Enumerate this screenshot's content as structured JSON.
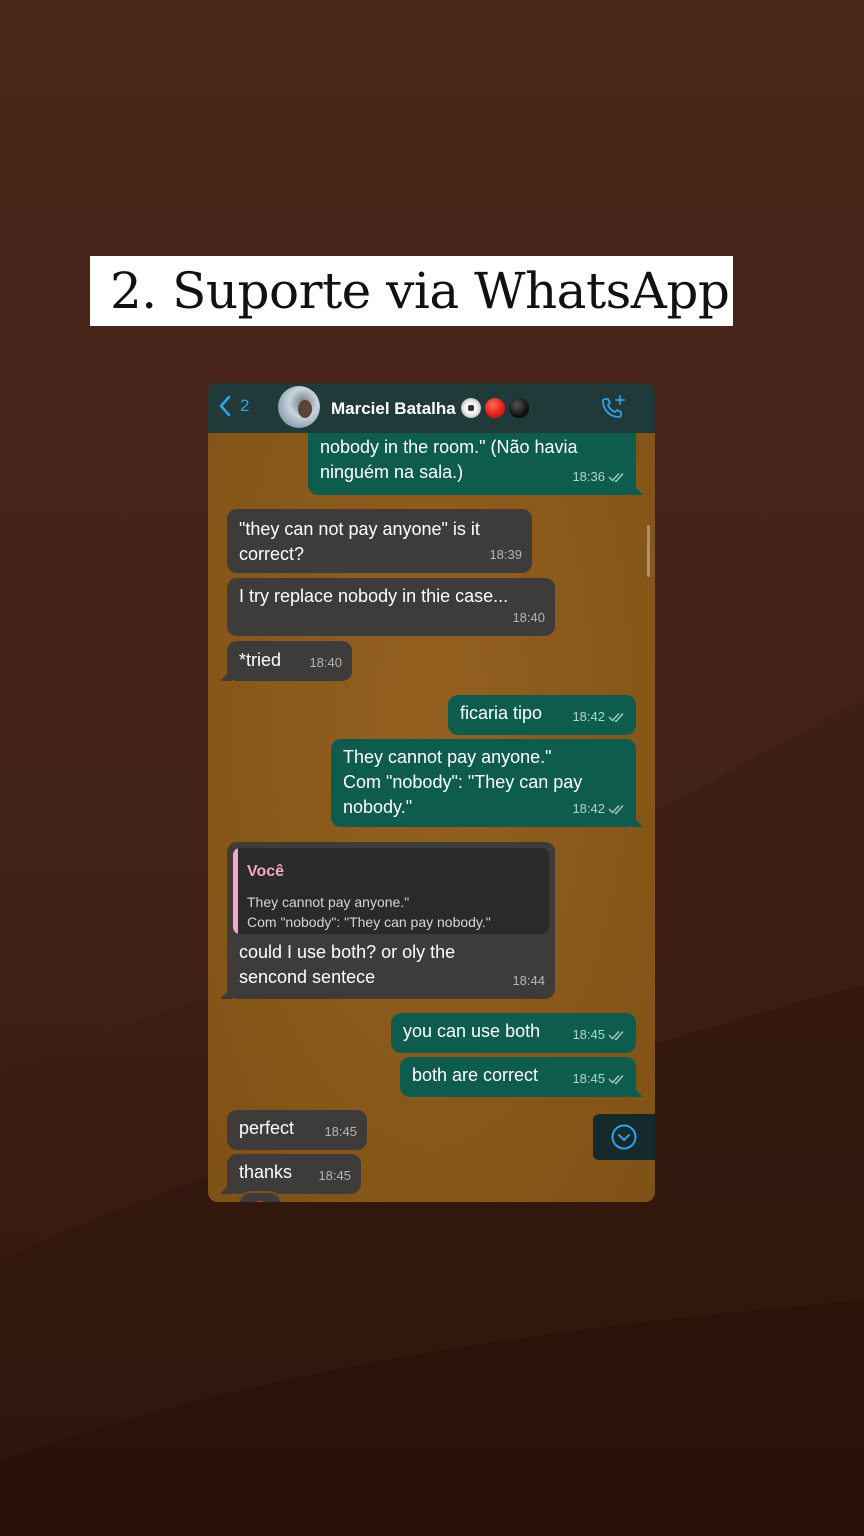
{
  "story": {
    "title": "2. Suporte via WhatsApp"
  },
  "header": {
    "back_count": "2",
    "contact_name": "Marciel Batalha",
    "status_emojis": [
      "soccer-ball",
      "red-circle",
      "black-circle"
    ]
  },
  "messages": [
    {
      "id": "m1",
      "dir": "out",
      "text": "nobody in the room.\" (Não havia\nninguém na sala.)",
      "time": "18:36",
      "read": true
    },
    {
      "id": "m2",
      "dir": "in",
      "text": "\"they can not pay anyone\" is it\ncorrect?",
      "time": "18:39"
    },
    {
      "id": "m3",
      "dir": "in",
      "text": "I try replace nobody in thie case...",
      "time": "18:40"
    },
    {
      "id": "m4",
      "dir": "in",
      "text": "*tried",
      "time": "18:40"
    },
    {
      "id": "m5",
      "dir": "out",
      "text": "ficaria tipo",
      "time": "18:42",
      "read": true
    },
    {
      "id": "m6",
      "dir": "out",
      "text": "They cannot pay anyone.\"\nCom \"nobody\": \"They can pay\nnobody.\"",
      "time": "18:42",
      "read": true
    },
    {
      "id": "m7",
      "dir": "in",
      "quote": {
        "author": "Você",
        "line1": "They cannot pay anyone.\"",
        "line2": "Com \"nobody\": \"They can pay nobody.\""
      },
      "text": "could I use both? or oly the\nsencond sentece",
      "time": "18:44"
    },
    {
      "id": "m8",
      "dir": "out",
      "text": "you can use both",
      "time": "18:45",
      "read": true
    },
    {
      "id": "m9",
      "dir": "out",
      "text": "both are correct",
      "time": "18:45",
      "read": true
    },
    {
      "id": "m10",
      "dir": "in",
      "text": "perfect",
      "time": "18:45"
    },
    {
      "id": "m11",
      "dir": "in",
      "text": "thanks",
      "time": "18:45",
      "reaction": "red-heart"
    }
  ],
  "colors": {
    "incoming_bubble": "#3d3c3a",
    "outgoing_bubble": "#0d5c4e",
    "header_bg": "#1f3a38",
    "chat_wallpaper": "#8b5a1f",
    "accent_blue": "#2fa3e6",
    "quote_accent": "#f4a8c8"
  }
}
